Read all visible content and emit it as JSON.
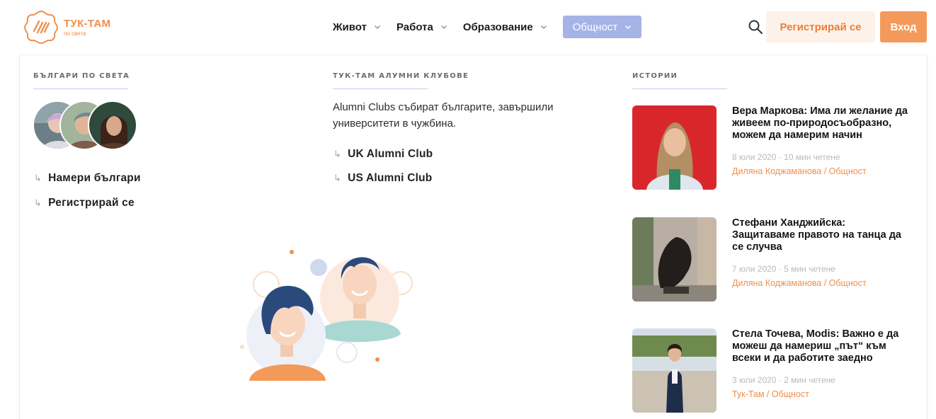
{
  "brand": {
    "name": "ТУК-ТАМ",
    "tagline": "по света",
    "accent_color": "#f08f4b",
    "secondary_color": "#a6b3e6"
  },
  "nav": {
    "items": [
      {
        "label": "Живот",
        "icon": "chevron-down-icon"
      },
      {
        "label": "Работа",
        "icon": "chevron-down-icon"
      },
      {
        "label": "Образование",
        "icon": "chevron-down-icon"
      },
      {
        "label": "Общност",
        "icon": "chevron-down-icon",
        "active": true
      }
    ]
  },
  "header": {
    "search_icon": "search-icon",
    "register_label": "Регистрирай се",
    "login_label": "Вход"
  },
  "menu": {
    "col1": {
      "heading": "БЪЛГАРИ ПО СВЕТА",
      "links": [
        "Намери българи",
        "Регистрирай се"
      ],
      "arrow": "↳"
    },
    "col2": {
      "heading": "ТУК-ТАМ АЛУМНИ КЛУБОВЕ",
      "description": "Alumni Clubs събират българите, завършили университети в чужбина.",
      "links": [
        "UK Alumni Club",
        "US Alumni Club"
      ],
      "arrow": "↳"
    },
    "col3": {
      "heading": "ИСТОРИИ",
      "stories": [
        {
          "title": "Вера Маркова: Има ли желание да живеем по-природосъобразно, можем да намерим начин",
          "meta": "8 юли 2020 · 10 мин четене",
          "author": "Диляна Коджаманова / Общност"
        },
        {
          "title": "Стефани Ханджийска: Защитаваме правото на танца да се случва",
          "meta": "7 юли 2020 · 5 мин четене",
          "author": "Диляна Коджаманова / Общност"
        },
        {
          "title": "Стела Точева, Modis: Важно е да можеш да намериш „път“ към всеки и да работите заедно",
          "meta": "3 юли 2020 · 2 мин четене",
          "author": "Тук-Там / Общност"
        }
      ]
    }
  }
}
